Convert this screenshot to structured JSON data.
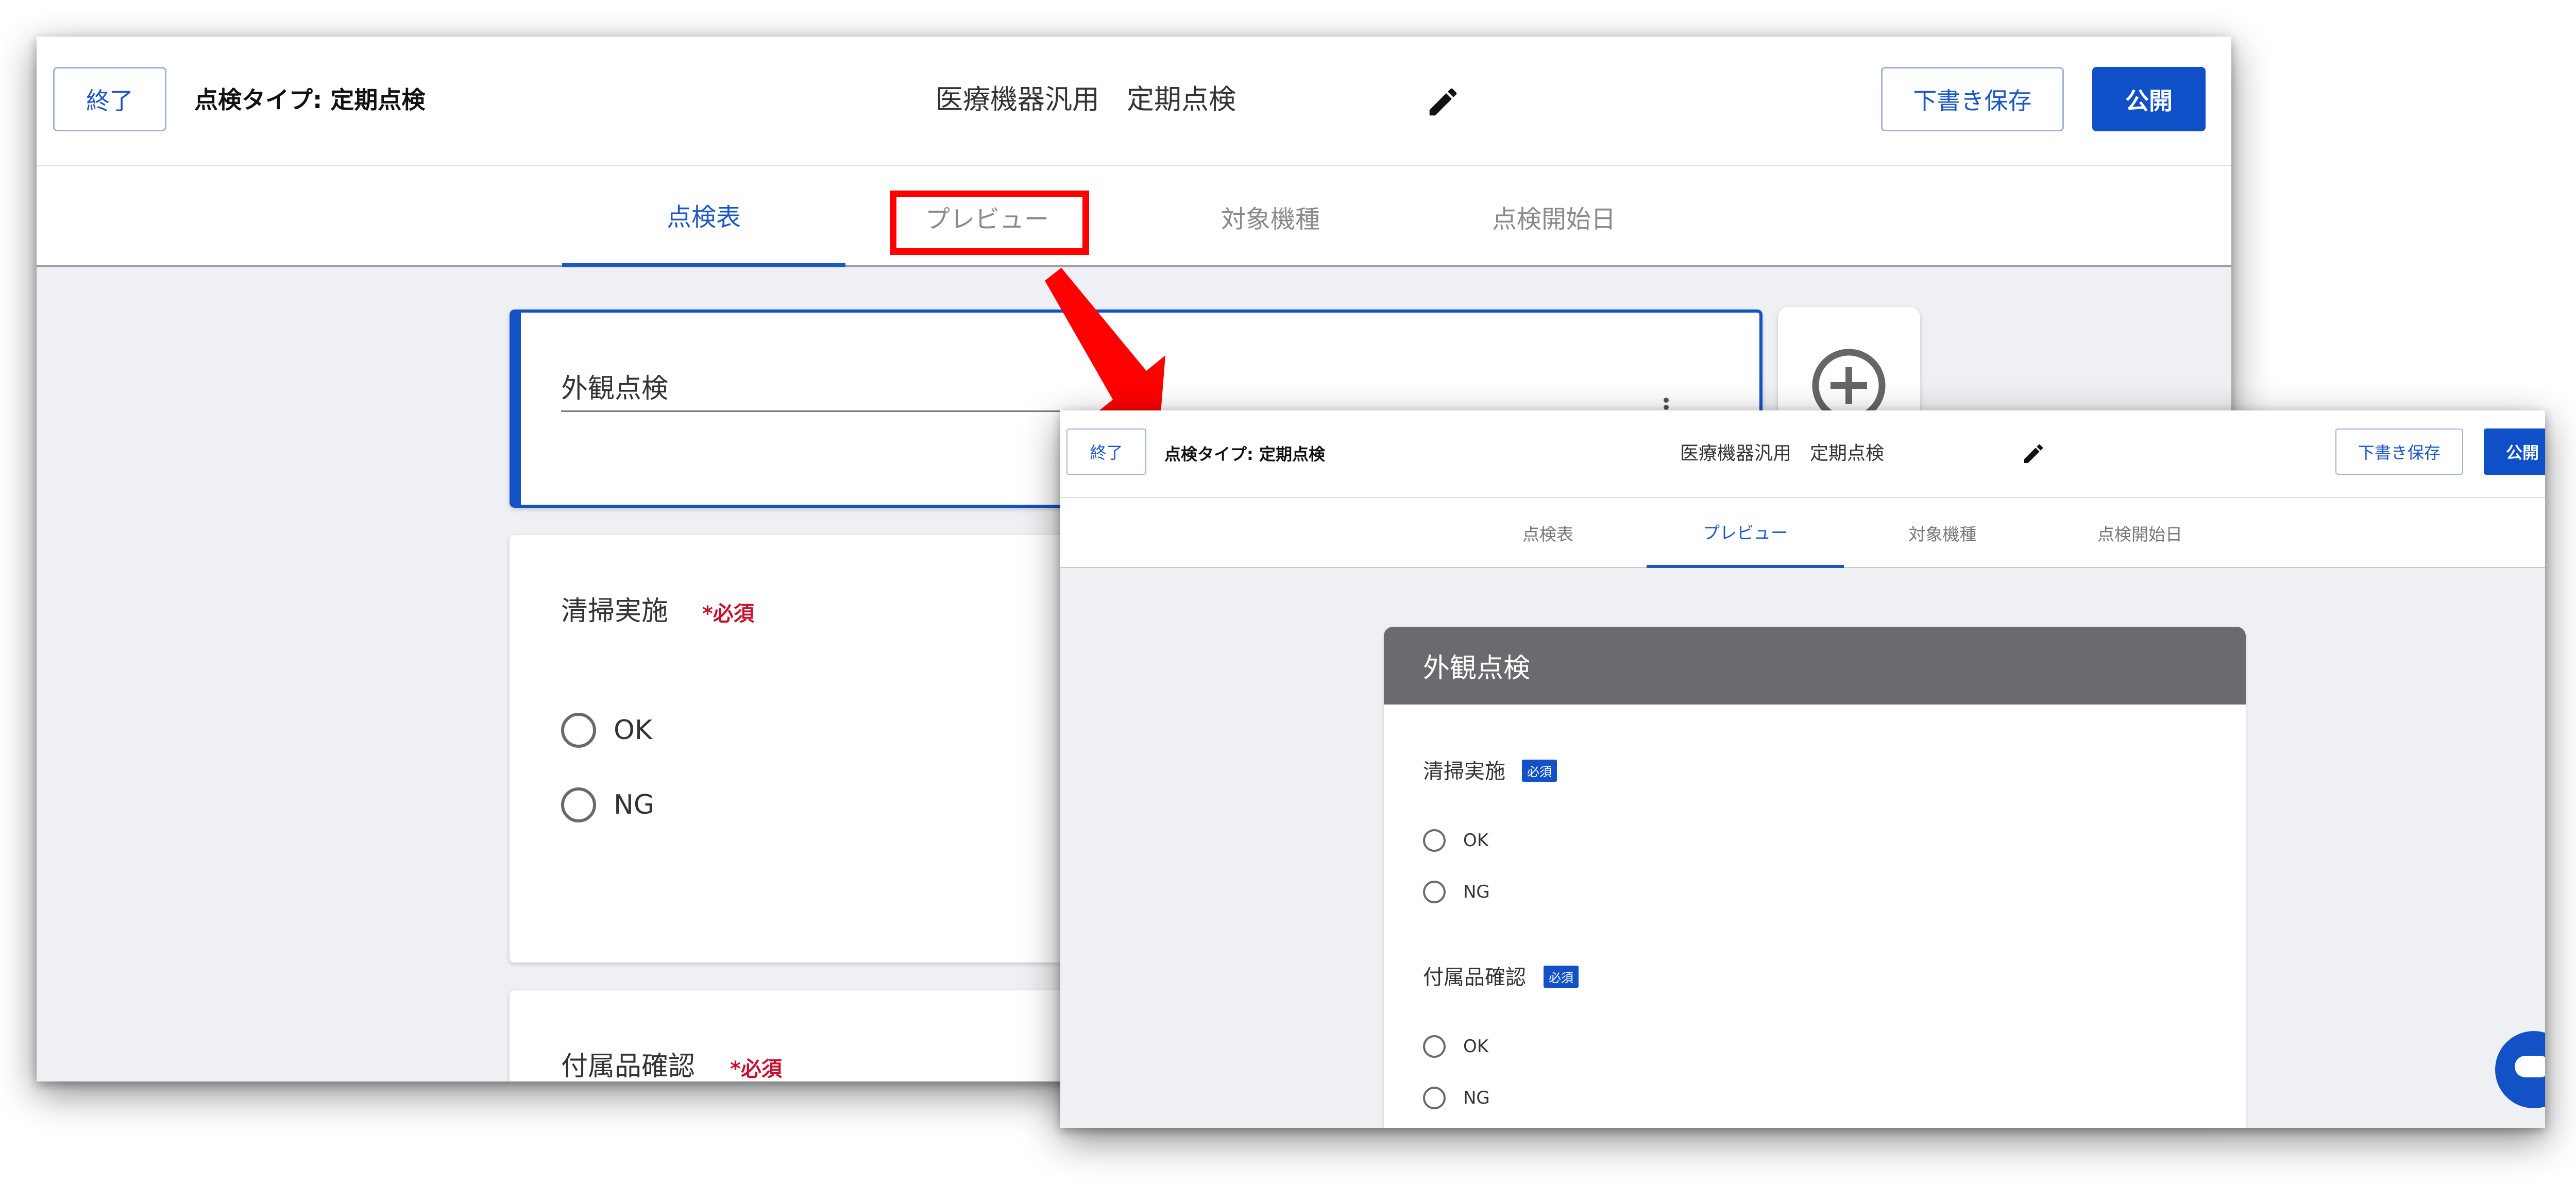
{
  "back_screen": {
    "header": {
      "exit_label": "終了",
      "type_label": "点検タイプ: 定期点検",
      "title": "医療機器汎用　定期点検",
      "draft_label": "下書き保存",
      "publish_label": "公開"
    },
    "tabs": [
      {
        "label": "点検表",
        "active": true
      },
      {
        "label": "プレビュー",
        "active": false
      },
      {
        "label": "対象機種",
        "active": false
      },
      {
        "label": "点検開始日",
        "active": false
      }
    ],
    "section": {
      "title": "外観点検"
    },
    "questions": [
      {
        "title": "清掃実施",
        "required_label": "*必須",
        "options": [
          "OK",
          "NG"
        ]
      },
      {
        "title": "付属品確認",
        "required_label": "*必須"
      }
    ],
    "icons": {
      "edit": "pencil-icon",
      "add": "add-circle-icon",
      "more": "more-vertical-icon"
    }
  },
  "front_screen": {
    "header": {
      "exit_label": "終了",
      "type_label": "点検タイプ: 定期点検",
      "title": "医療機器汎用　定期点検",
      "draft_label": "下書き保存",
      "publish_label": "公開"
    },
    "tabs": [
      {
        "label": "点検表",
        "active": false
      },
      {
        "label": "プレビュー",
        "active": true
      },
      {
        "label": "対象機種",
        "active": false
      },
      {
        "label": "点検開始日",
        "active": false
      }
    ],
    "preview": {
      "section_title": "外観点検",
      "questions": [
        {
          "title": "清掃実施",
          "required_label": "必須",
          "options": [
            "OK",
            "NG"
          ]
        },
        {
          "title": "付属品確認",
          "required_label": "必須",
          "options": [
            "OK",
            "NG"
          ]
        }
      ]
    }
  },
  "annotation": {
    "highlight_color": "#ff0000",
    "arrow_color": "#ff0000"
  },
  "colors": {
    "accent": "#1351c6",
    "required": "#c8102e",
    "preview_header": "#6a6b6e"
  }
}
